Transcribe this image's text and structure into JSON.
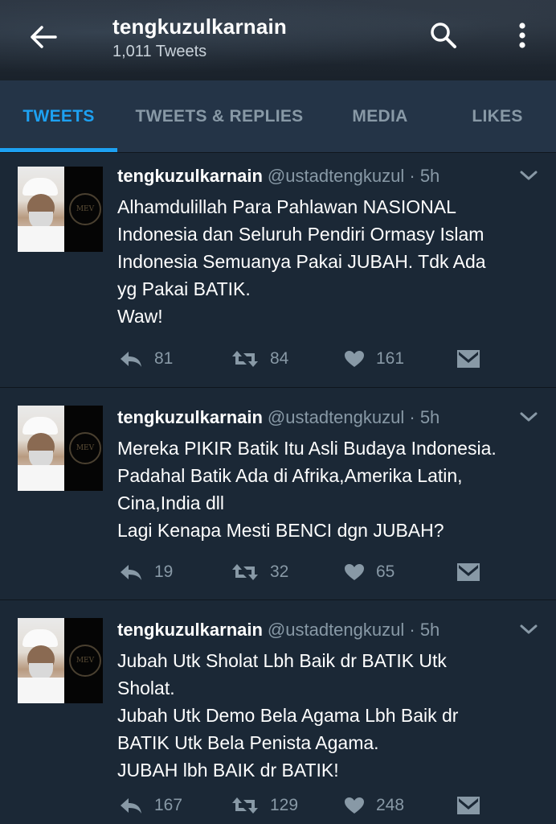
{
  "header": {
    "title": "tengkuzulkarnain",
    "subtitle": "1,011 Tweets"
  },
  "tabs": [
    {
      "label": "TWEETS",
      "active": true
    },
    {
      "label": "TWEETS & REPLIES",
      "active": false
    },
    {
      "label": "MEDIA",
      "active": false
    },
    {
      "label": "LIKES",
      "active": false
    }
  ],
  "tweets": [
    {
      "name": "tengkuzulkarnain",
      "handle": "@ustadtengkuzul",
      "time": "· 5h",
      "lines": [
        "Alhamdulillah Para Pahlawan NASIONAL",
        "Indonesia dan Seluruh Pendiri Ormasy Islam",
        "Indonesia Semuanya Pakai JUBAH. Tdk Ada",
        "yg Pakai BATIK.",
        "Waw!"
      ],
      "replies": "81",
      "retweets": "84",
      "likes": "161"
    },
    {
      "name": "tengkuzulkarnain",
      "handle": "@ustadtengkuzul",
      "time": "· 5h",
      "lines": [
        "Mereka PIKIR Batik Itu Asli Budaya Indonesia.",
        "Padahal Batik Ada di Afrika,Amerika Latin,",
        "Cina,India dll",
        "Lagi Kenapa Mesti BENCI dgn JUBAH?"
      ],
      "replies": "19",
      "retweets": "32",
      "likes": "65"
    },
    {
      "name": "tengkuzulkarnain",
      "handle": "@ustadtengkuzul",
      "time": "· 5h",
      "lines": [
        "Jubah Utk Sholat Lbh Baik dr BATIK Utk",
        "Sholat.",
        "Jubah Utk Demo Bela Agama Lbh Baik dr",
        "BATIK Utk Bela Penista Agama.",
        "JUBAH lbh BAIK dr BATIK!"
      ],
      "replies": "167",
      "retweets": "129",
      "likes": "248"
    }
  ],
  "icons": {
    "back": "back-arrow-icon",
    "search": "search-icon",
    "more": "more-vertical-icon",
    "reply": "reply-icon",
    "retweet": "retweet-icon",
    "like": "heart-icon",
    "dm": "direct-message-icon",
    "caret": "chevron-down-icon"
  },
  "colors": {
    "accent": "#1da1f2",
    "background": "#1b2836",
    "tab_bar": "#243447",
    "muted": "#8899a6"
  }
}
